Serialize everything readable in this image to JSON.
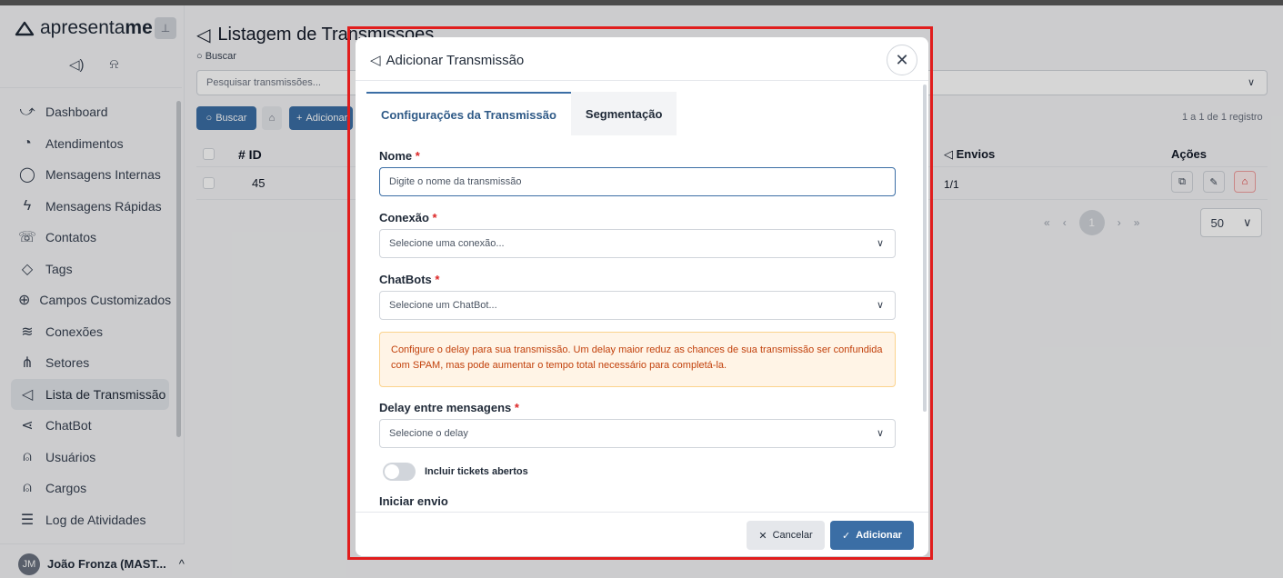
{
  "app": {
    "brand_prefix": "apresenta",
    "brand_suffix": "me",
    "pin_icon": "pin-icon"
  },
  "sidebar": {
    "items": [
      {
        "label": "Dashboard",
        "icon": "chart-line-icon",
        "glyph": "⤻"
      },
      {
        "label": "Atendimentos",
        "icon": "whatsapp-icon",
        "glyph": "◔"
      },
      {
        "label": "Mensagens Internas",
        "icon": "chat-bubble-icon",
        "glyph": "◯"
      },
      {
        "label": "Mensagens Rápidas",
        "icon": "lightning-icon",
        "glyph": "ϟ"
      },
      {
        "label": "Contatos",
        "icon": "phone-icon",
        "glyph": "☏"
      },
      {
        "label": "Tags",
        "icon": "tag-icon",
        "glyph": "◇"
      },
      {
        "label": "Campos Customizados",
        "icon": "plus-circle-icon",
        "glyph": "⊕"
      },
      {
        "label": "Conexões",
        "icon": "wifi-icon",
        "glyph": "≋"
      },
      {
        "label": "Setores",
        "icon": "sitemap-icon",
        "glyph": "⋔"
      },
      {
        "label": "Lista de Transmissão",
        "icon": "megaphone-icon",
        "glyph": "◁"
      },
      {
        "label": "ChatBot",
        "icon": "share-icon",
        "glyph": "⋖"
      },
      {
        "label": "Usuários",
        "icon": "user-icon",
        "glyph": "⍝"
      },
      {
        "label": "Cargos",
        "icon": "users-icon",
        "glyph": "⍝"
      },
      {
        "label": "Log de Atividades",
        "icon": "list-icon",
        "glyph": "☰"
      }
    ],
    "active_index": 9,
    "user": {
      "initials": "JM",
      "name": "João Fronza (MAST...",
      "caret": "^"
    }
  },
  "main": {
    "title": "Listagem de Transmissões",
    "search_label": "Buscar",
    "search_placeholder": "Pesquisar transmissões...",
    "buscar_button": "Buscar",
    "add_button": "Adicionar",
    "record_count": "1 a 1 de 1 registro",
    "table": {
      "headers": {
        "id": "# ID",
        "envios": "Envios",
        "acoes": "Ações"
      },
      "rows": [
        {
          "id": "45",
          "envios": "1/1"
        }
      ]
    },
    "pagination": {
      "first": "«",
      "prev": "‹",
      "current": "1",
      "next": "›",
      "last": "»",
      "page_size": "50"
    }
  },
  "modal": {
    "title": "Adicionar Transmissão",
    "tabs": [
      {
        "label": "Configurações da Transmissão",
        "active": true
      },
      {
        "label": "Segmentação",
        "active": false
      }
    ],
    "fields": {
      "nome": {
        "label": "Nome",
        "placeholder": "Digite o nome da transmissão"
      },
      "conexao": {
        "label": "Conexão",
        "placeholder": "Selecione uma conexão..."
      },
      "chatbots": {
        "label": "ChatBots",
        "placeholder": "Selecione um ChatBot..."
      },
      "delay": {
        "label": "Delay entre mensagens",
        "placeholder": "Selecione o delay"
      },
      "iniciar": {
        "label": "Iniciar envio"
      }
    },
    "required_mark": "*",
    "alert": "Configure o delay para sua transmissão. Um delay maior reduz as chances de sua transmissão ser confundida com SPAM, mas pode aumentar o tempo total necessário para completá-la.",
    "toggle_label": "Incluir tickets abertos",
    "toggle_on": false,
    "cancel_button": "Cancelar",
    "submit_button": "Adicionar"
  },
  "colors": {
    "primary": "#3b6ea5",
    "danger": "#dc2626",
    "highlight": "#e11d1d",
    "alert_bg": "#fff4e6",
    "alert_text": "#c2410c"
  }
}
